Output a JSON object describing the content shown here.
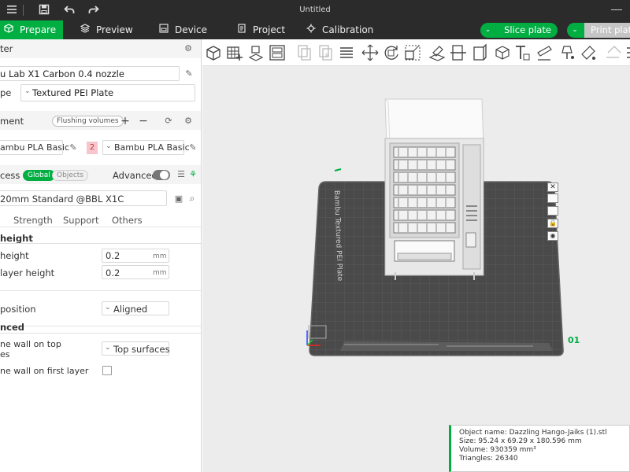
{
  "window": {
    "title": "Untitled"
  },
  "tabs": [
    {
      "label": "Prepare",
      "icon": "cube-icon"
    },
    {
      "label": "Preview",
      "icon": "layers-icon"
    },
    {
      "label": "Device",
      "icon": "device-icon"
    },
    {
      "label": "Project",
      "icon": "project-icon"
    },
    {
      "label": "Calibration",
      "icon": "calibration-icon"
    }
  ],
  "actions": {
    "slice_label": "Slice plate",
    "print_label": "Print plate"
  },
  "printer": {
    "section_label": "ter",
    "printer_value": "u Lab X1 Carbon 0.4 nozzle",
    "plate_label": "pe",
    "plate_value": "Textured PEI Plate"
  },
  "filament": {
    "section_label": "ment",
    "flushing_label": "Flushing volumes",
    "slot1_value": "ambu PLA Basic",
    "slot2_badge": "2",
    "slot2_value": "Bambu PLA Basic"
  },
  "process": {
    "section_label": "cess",
    "global_label": "Global",
    "objects_label": "Objects",
    "advanced_label": "Advanced",
    "preset_value": "20mm Standard @BBL X1C",
    "subtabs": [
      "Strength",
      "Support",
      "Others"
    ]
  },
  "settings": {
    "layer_height_header": "height",
    "layer_height_label": "height",
    "layer_height_value": "0.2",
    "layer_height_unit": "mm",
    "first_layer_label": "layer height",
    "first_layer_value": "0.2",
    "first_layer_unit": "mm",
    "seam_label": "position",
    "seam_value": "Aligned",
    "advanced_header": "nced",
    "one_wall_top_label_1": "ne wall on top",
    "one_wall_top_label_2": "es",
    "one_wall_top_value": "Top surfaces",
    "one_wall_first_label": "ne wall on first layer"
  },
  "viewport": {
    "plate_text": "Bambu Textured PEI Plate",
    "plate_number": "01"
  },
  "object_info": {
    "name_line": "Object name: Dazzling Hango-Jaiks (1).stl",
    "size_line": "Size: 95.24 x 69.29 x 180.596 mm",
    "volume_line": "Volume: 930359 mm³",
    "triangles_line": "Triangles: 26340"
  },
  "colors": {
    "accent": "#00ae42",
    "titlebar": "#2b2b2b",
    "plate": "#4a4a4a",
    "viewport_bg": "#ececec",
    "badge_pink": "#f7c5ce"
  }
}
